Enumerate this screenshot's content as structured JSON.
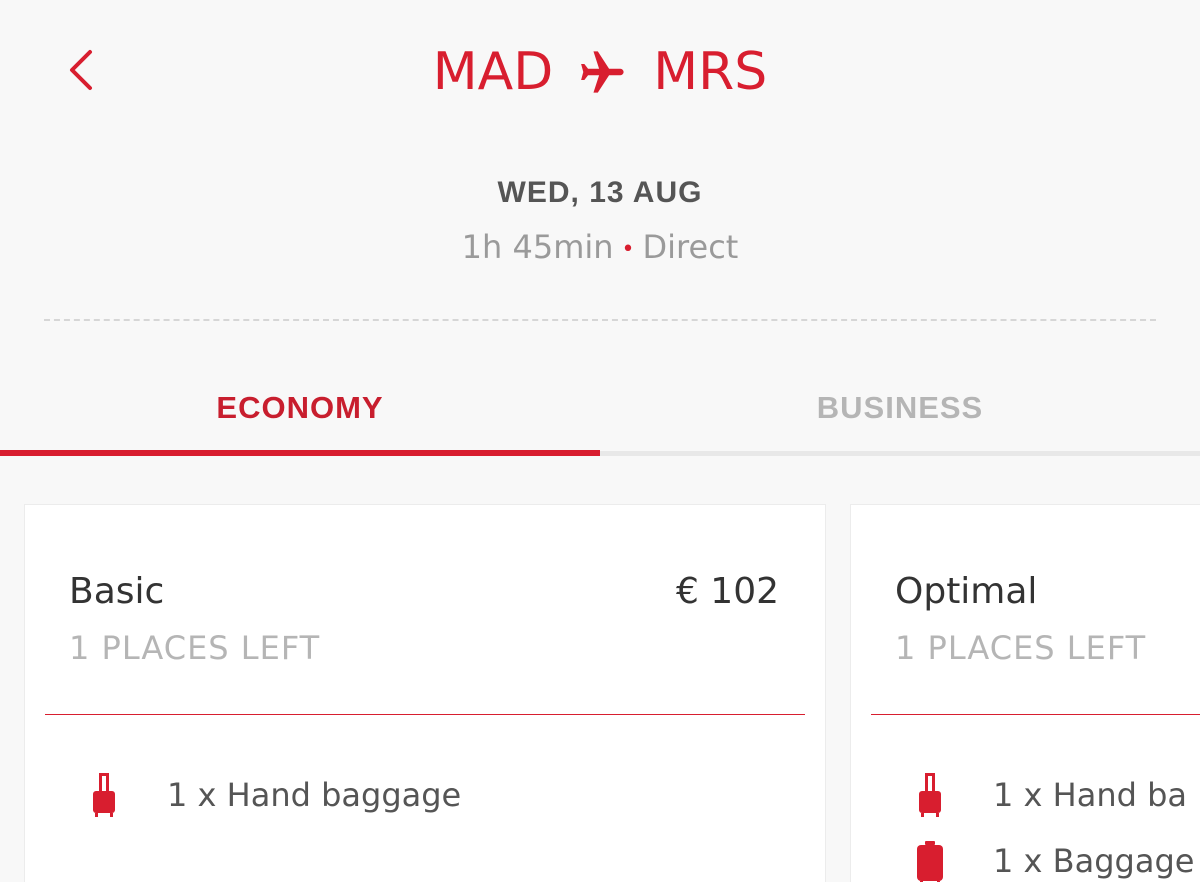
{
  "header": {
    "origin": "MAD",
    "destination": "MRS",
    "date": "WED, 13 AUG",
    "duration": "1h 45min",
    "stops": "Direct"
  },
  "tabs": [
    {
      "label": "ECONOMY",
      "active": true
    },
    {
      "label": "BUSINESS",
      "active": false
    }
  ],
  "fares": [
    {
      "name": "Basic",
      "price": "€ 102",
      "availability": "1 PLACES LEFT",
      "features": [
        "1 x Hand baggage"
      ]
    },
    {
      "name": "Optimal",
      "availability": "1 PLACES LEFT",
      "features": [
        "1 x Hand ba",
        "1 x Baggage"
      ]
    }
  ],
  "colors": {
    "accent": "#d81e2f",
    "background": "#f8f8f8",
    "card": "#ffffff",
    "muted_text": "#b5b5b5",
    "body_text": "#555555"
  },
  "icons": {
    "back": "chevron-left-icon",
    "route": "airplane-icon",
    "hand_baggage": "hand-luggage-icon",
    "checked_baggage": "suitcase-icon"
  }
}
